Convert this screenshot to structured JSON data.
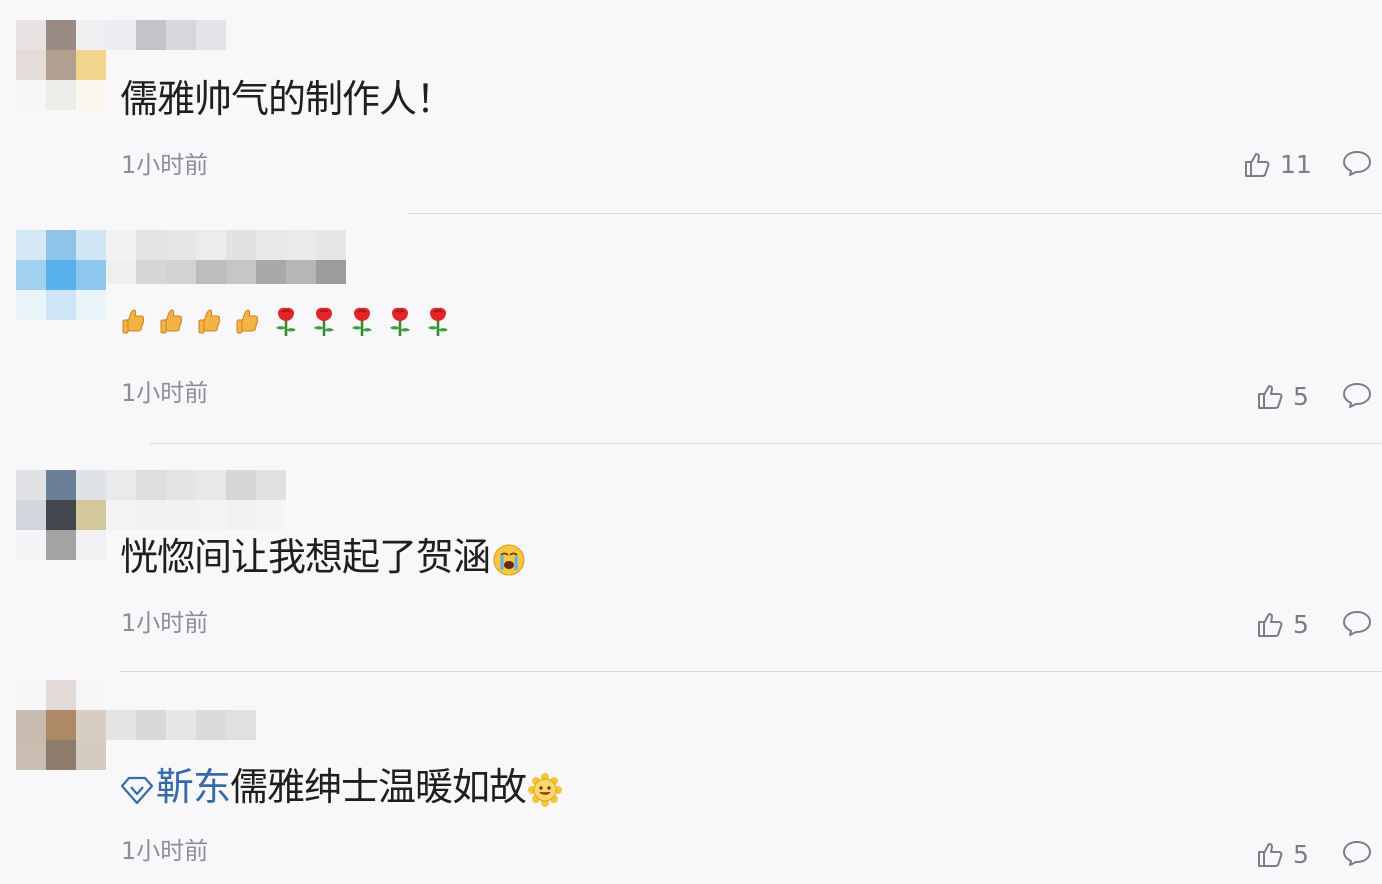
{
  "comments": [
    {
      "text": "儒雅帅气的制作人！",
      "time": "1小时前",
      "likes": "11"
    },
    {
      "emojis": [
        "thumbs-up",
        "thumbs-up",
        "thumbs-up",
        "thumbs-up",
        "rose",
        "rose",
        "rose",
        "rose",
        "rose"
      ],
      "time": "1小时前",
      "likes": "5"
    },
    {
      "text": "恍惚间让我想起了贺涵",
      "trailing_emoji": "crying-face",
      "time": "1小时前",
      "likes": "5"
    },
    {
      "mention": "靳东",
      "text": "儒雅绅士温暖如故",
      "trailing_emoji": "sunflower-smile",
      "time": "1小时前",
      "likes": "5"
    }
  ],
  "icons": {
    "like": "thumbs-up-outline-icon",
    "reply": "speech-bubble-icon",
    "mention": "diamond-badge-icon"
  },
  "colors": {
    "background": "#f8f8fa",
    "text": "#1f1f1f",
    "meta": "#8d8d94",
    "mention": "#3a69a8",
    "divider": "#dcdce0"
  }
}
